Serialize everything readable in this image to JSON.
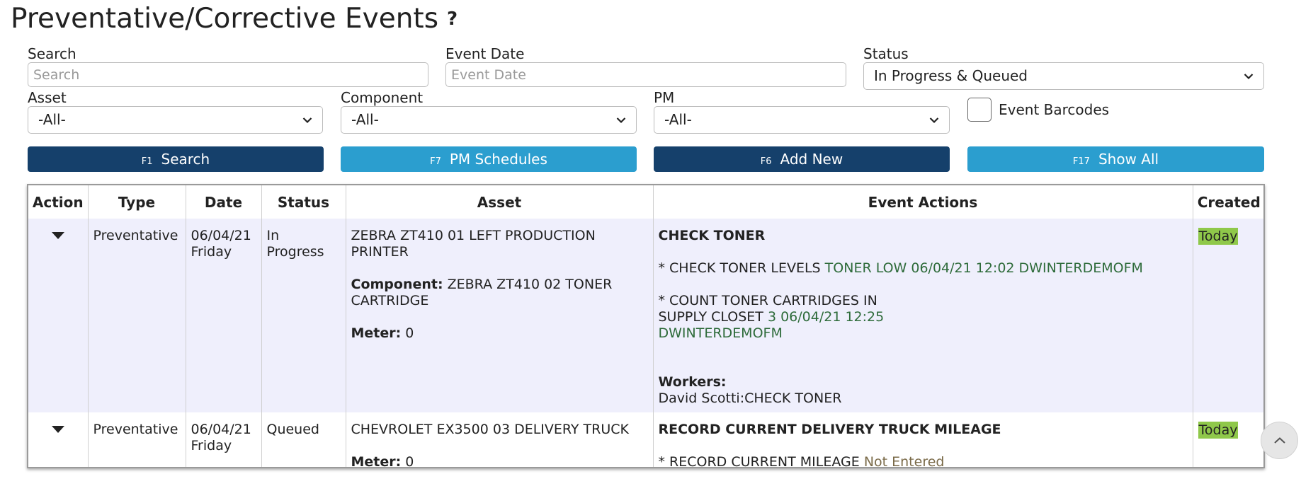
{
  "page": {
    "title": "Preventative/Corrective Events",
    "help": "?"
  },
  "filters": {
    "search": {
      "label": "Search",
      "placeholder": "Search",
      "value": ""
    },
    "event_date": {
      "label": "Event Date",
      "placeholder": "Event Date",
      "value": ""
    },
    "status": {
      "label": "Status",
      "value": "In Progress & Queued"
    },
    "asset": {
      "label": "Asset",
      "value": "-All-"
    },
    "component": {
      "label": "Component",
      "value": "-All-"
    },
    "pm": {
      "label": "PM",
      "value": "-All-"
    },
    "event_barcodes": {
      "label": "Event Barcodes",
      "checked": false
    }
  },
  "buttons": {
    "search": {
      "hotkey": "F1",
      "label": "Search"
    },
    "pm_schedules": {
      "hotkey": "F7",
      "label": "PM Schedules"
    },
    "add_new": {
      "hotkey": "F6",
      "label": "Add New"
    },
    "show_all": {
      "hotkey": "F17",
      "label": "Show All"
    }
  },
  "colors": {
    "button_dark": "#15406b",
    "button_light": "#2b9ecf",
    "row_highlight": "#efeffc",
    "badge_today": "#8fc84a",
    "value_green": "#2e6b3a",
    "value_pending": "#7a6a48"
  },
  "table": {
    "headers": [
      "Action",
      "Type",
      "Date",
      "Status",
      "Asset",
      "Event Actions",
      "Created"
    ],
    "rows": [
      {
        "type": "Preventative",
        "date_line1": "06/04/21",
        "date_line2": "Friday",
        "status": "In Progress",
        "asset_name": "ZEBRA ZT410 01 LEFT PRODUCTION PRINTER",
        "component_label": "Component:",
        "component_value": "ZEBRA ZT410 02 TONER CARTRIDGE",
        "meter_label": "Meter:",
        "meter_value": "0",
        "event_title": "CHECK TONER",
        "actions": [
          {
            "text": "* CHECK TONER LEVELS",
            "result": "TONER LOW 06/04/21 12:02 DWINTERDEMOFM"
          },
          {
            "text": "* COUNT TONER CARTRIDGES IN SUPPLY CLOSET",
            "result": "3 06/04/21 12:25 DWINTERDEMOFM"
          }
        ],
        "workers_label": "Workers:",
        "workers_value": "David Scotti:CHECK TONER",
        "created": "Today"
      },
      {
        "type": "Preventative",
        "date_line1": "06/04/21",
        "date_line2": "Friday",
        "status": "Queued",
        "asset_name": "CHEVROLET EX3500 03 DELIVERY TRUCK",
        "meter_label": "Meter:",
        "meter_value": "0",
        "event_title": "RECORD CURRENT DELIVERY TRUCK MILEAGE",
        "actions": [
          {
            "text": "* RECORD CURRENT MILEAGE",
            "result": "Not Entered"
          }
        ],
        "created": "Today"
      }
    ]
  }
}
